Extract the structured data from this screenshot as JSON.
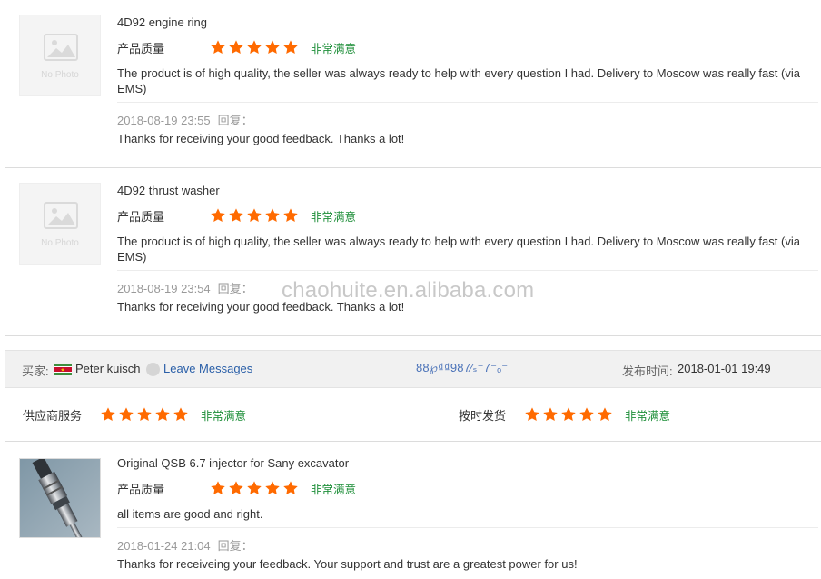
{
  "reviews": [
    {
      "product": "4D92 engine ring",
      "thumb_text": "No Photo",
      "rating_label": "产品质量",
      "rating_stars": 5,
      "satisfaction": "非常满意",
      "text": "The product is of high quality, the seller was always ready to help with every question I had. Delivery to Moscow was really fast (via EMS)",
      "date": "2018-08-19 23:55",
      "reply_label": "回复：",
      "reply": "Thanks for receiving your good feedback. Thanks a lot!"
    },
    {
      "product": "4D92 thrust washer",
      "thumb_text": "No Photo",
      "rating_label": "产品质量",
      "rating_stars": 5,
      "satisfaction": "非常满意",
      "text": "The product is of high quality, the seller was always ready to help with every question I had. Delivery to Moscow was really fast (via EMS)",
      "date": "2018-08-19 23:54",
      "reply_label": "回复：",
      "reply": "Thanks for receiving your good feedback. Thanks a lot!"
    }
  ],
  "watermark": "chaohuite.en.alibaba.com",
  "buyer": {
    "label": "买家:",
    "name": "Peter kuisch",
    "message_link": "Leave Messages",
    "order_no": "88℘₫₫987⁄ₛ⁻7⁻ₒ⁻",
    "time_label": "发布时间:",
    "time": "2018-01-01 19:49"
  },
  "services": [
    {
      "label": "供应商服务",
      "stars": 5,
      "satisfaction": "非常满意"
    },
    {
      "label": "按时发货",
      "stars": 5,
      "satisfaction": "非常满意"
    }
  ],
  "review3": {
    "product": "Original QSB 6.7 injector for Sany excavator",
    "rating_label": "产品质量",
    "rating_stars": 5,
    "satisfaction": "非常满意",
    "text": "all items are good and right.",
    "date": "2018-01-24 21:04",
    "reply_label": "回复：",
    "reply": "Thanks for receiveing your feedback. Your support and trust are a greatest power for us!"
  },
  "colors": {
    "star": "#ff6a00",
    "satisfaction": "#1f8f3a",
    "link": "#2a5fa8",
    "bar_bg": "#f1f1f1"
  }
}
